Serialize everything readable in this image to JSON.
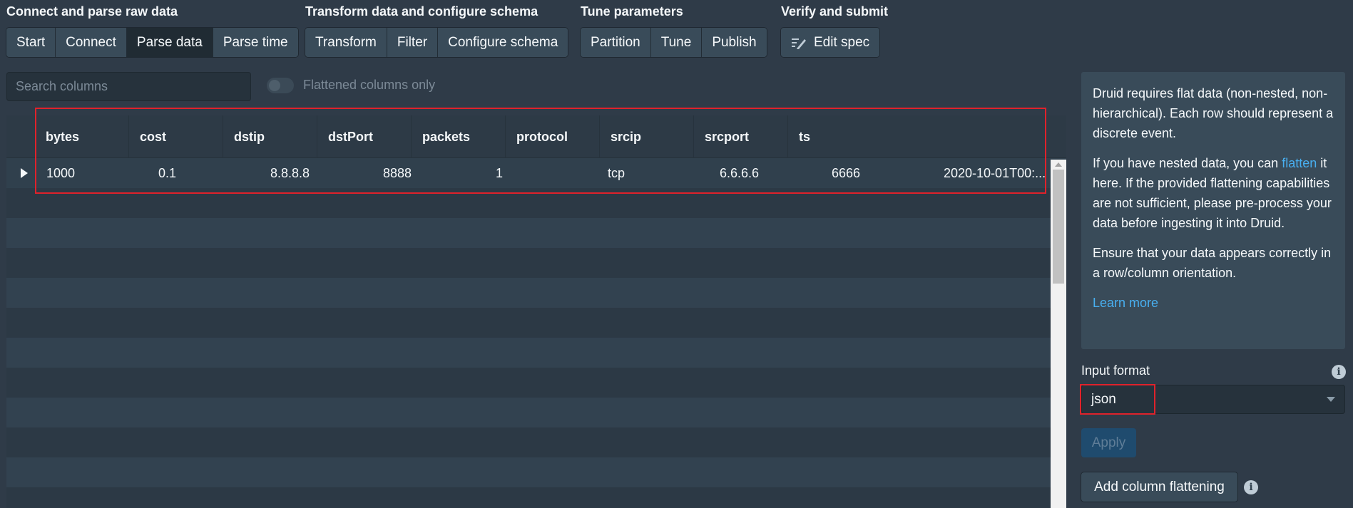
{
  "stages": [
    {
      "title": "Connect and parse raw data",
      "steps": [
        "Start",
        "Connect",
        "Parse data",
        "Parse time"
      ],
      "active": "Parse data"
    },
    {
      "title": "Transform data and configure schema",
      "steps": [
        "Transform",
        "Filter",
        "Configure schema"
      ]
    },
    {
      "title": "Tune parameters",
      "steps": [
        "Partition",
        "Tune",
        "Publish"
      ]
    },
    {
      "title": "Verify and submit",
      "steps": [
        "Edit spec"
      ]
    }
  ],
  "search": {
    "placeholder": "Search columns"
  },
  "toggle": {
    "label": "Flattened columns only",
    "on": false
  },
  "table": {
    "columns": [
      "bytes",
      "cost",
      "dstip",
      "dstPort",
      "packets",
      "protocol",
      "srcip",
      "srcport",
      "ts"
    ],
    "rows": [
      [
        "1000",
        "0.1",
        "8.8.8.8",
        "8888",
        "1",
        "tcp",
        "6.6.6.6",
        "6666",
        "2020-10-01T00:..."
      ]
    ]
  },
  "info": {
    "p1": "Druid requires flat data (non-nested, non-hierarchical). Each row should represent a discrete event.",
    "p2_before": "If you have nested data, you can ",
    "p2_link": "flatten",
    "p2_after": " it here. If the provided flattening capabilities are not sufficient, please pre-process your data before ingesting it into Druid.",
    "p3": "Ensure that your data appears correctly in a row/column orientation.",
    "learn_more": "Learn more"
  },
  "input_format": {
    "label": "Input format",
    "value": "json"
  },
  "buttons": {
    "apply": "Apply",
    "add_flattening": "Add column flattening"
  },
  "colors": {
    "accent_link": "#48aff0",
    "highlight": "#e0222b",
    "background": "#2f3b48"
  }
}
